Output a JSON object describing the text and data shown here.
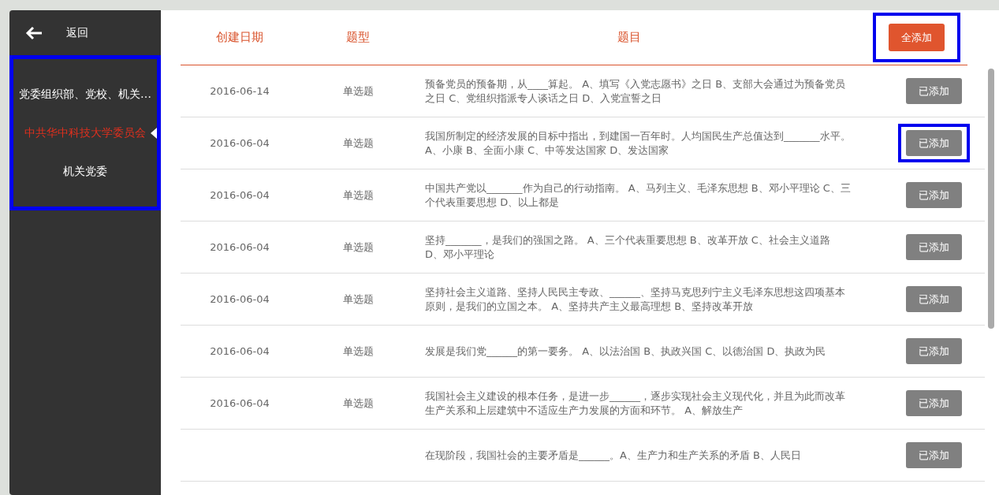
{
  "sidebar": {
    "back": {
      "label": "返回"
    },
    "highlighted": true,
    "items": [
      {
        "label": "党委组织部、党校、机关…",
        "selected": false
      },
      {
        "label": "中共华中科技大学委员会",
        "selected": true
      },
      {
        "label": "机关党委",
        "selected": false
      }
    ]
  },
  "table": {
    "columns": [
      "创建日期",
      "题型",
      "题目"
    ],
    "add_all": {
      "label": "全添加",
      "highlighted": true
    },
    "rows": [
      {
        "date": "2016-06-14",
        "type": "单选题",
        "question": "预备党员的预备期，从____算起。 A、填写《入党志愿书》之日 B、支部大会通过为预备党员之日 C、党组织指派专人谈话之日 D、入党宣誓之日",
        "button": "已添加",
        "added": true,
        "highlighted": false
      },
      {
        "date": "2016-06-04",
        "type": "单选题",
        "question": "我国所制定的经济发展的目标中指出，到建国一百年时。人均国民生产总值达到_______水平。 A、小康 B、全面小康 C、中等发达国家 D、发达国家",
        "button": "已添加",
        "added": true,
        "highlighted": true
      },
      {
        "date": "2016-06-04",
        "type": "单选题",
        "question": "中国共产党以_______作为自己的行动指南。 A、马列主义、毛泽东思想 B、邓小平理论 C、三个代表重要思想 D、以上都是",
        "button": "已添加",
        "added": true,
        "highlighted": false
      },
      {
        "date": "2016-06-04",
        "type": "单选题",
        "question": "坚持_______，是我们的强国之路。 A、三个代表重要思想 B、改革开放 C、社会主义道路 D、邓小平理论",
        "button": "已添加",
        "added": true,
        "highlighted": false
      },
      {
        "date": "2016-06-04",
        "type": "单选题",
        "question": "坚持社会主义道路、坚持人民民主专政、______、坚持马克思列宁主义毛泽东思想这四项基本原则，是我们的立国之本。 A、坚持共产主义最高理想 B、坚持改革开放",
        "button": "已添加",
        "added": true,
        "highlighted": false
      },
      {
        "date": "2016-06-04",
        "type": "单选题",
        "question": "发展是我们党______的第一要务。 A、以法治国 B、执政兴国 C、以德治国 D、执政为民",
        "button": "已添加",
        "added": true,
        "highlighted": false
      },
      {
        "date": "2016-06-04",
        "type": "单选题",
        "question": "我国社会主义建设的根本任务，是进一步______，逐步实现社会主义现代化，并且为此而改革生产关系和上层建筑中不适应生产力发展的方面和环节。 A、解放生产",
        "button": "已添加",
        "added": true,
        "highlighted": false
      },
      {
        "date": "",
        "type": "",
        "question": "在现阶段，我国社会的主要矛盾是______。A、生产力和生产关系的矛盾 B、人民日",
        "button": "已添加",
        "added": true,
        "highlighted": false
      }
    ]
  }
}
